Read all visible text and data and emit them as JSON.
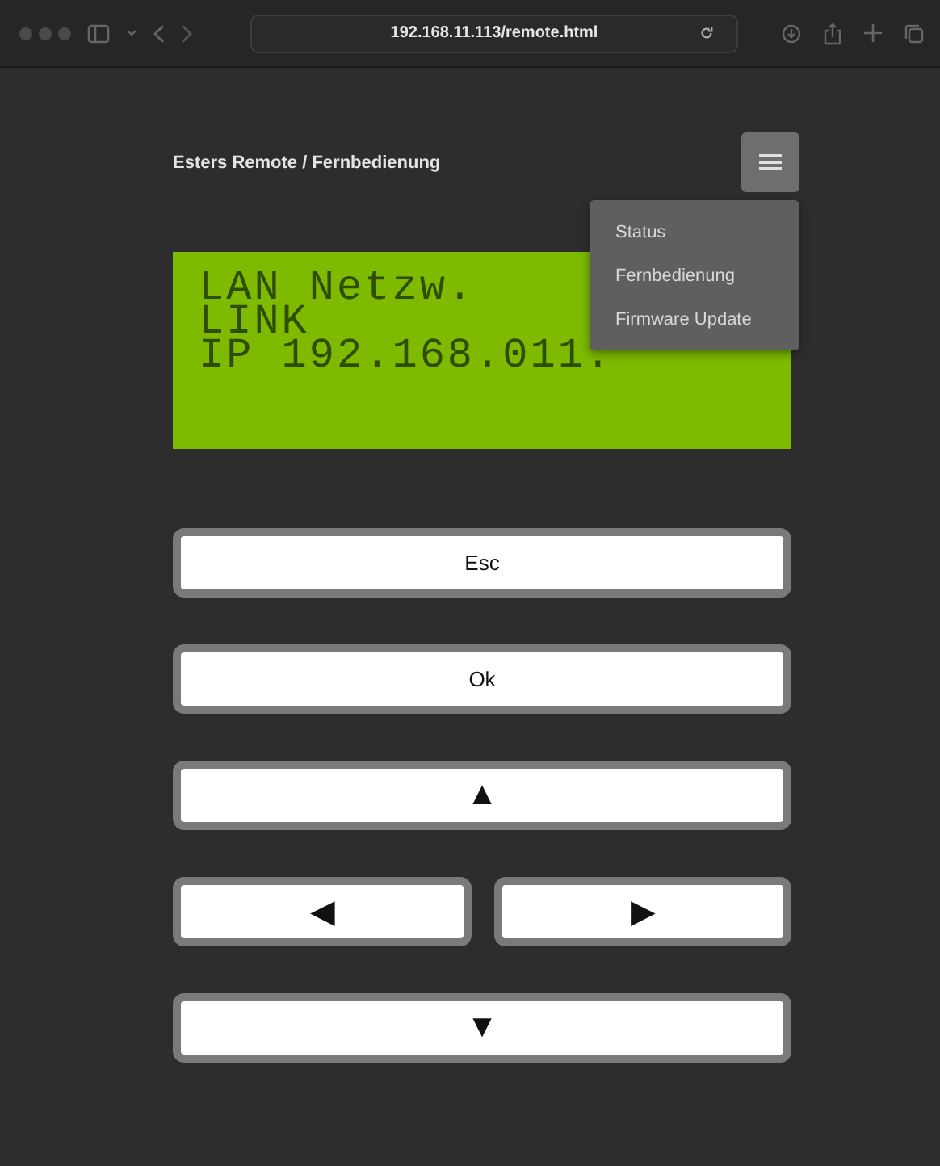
{
  "browser": {
    "address": "192.168.11.113/remote.html"
  },
  "header": {
    "title": "Esters Remote / Fernbedienung"
  },
  "menu": {
    "expanded": true,
    "items": [
      {
        "label": "Status"
      },
      {
        "label": "Fernbedienung"
      },
      {
        "label": "Firmware Update"
      }
    ]
  },
  "display": {
    "lines": [
      "LAN Netzw.",
      "LINK",
      "IP 192.168.011."
    ]
  },
  "buttons": [
    [
      {
        "label": "Esc"
      }
    ],
    [
      {
        "label": "Ok"
      }
    ],
    [
      {
        "label": "▲"
      }
    ],
    [
      {
        "label": "◀"
      },
      {
        "label": "▶"
      }
    ],
    [
      {
        "label": "▼"
      }
    ]
  ]
}
